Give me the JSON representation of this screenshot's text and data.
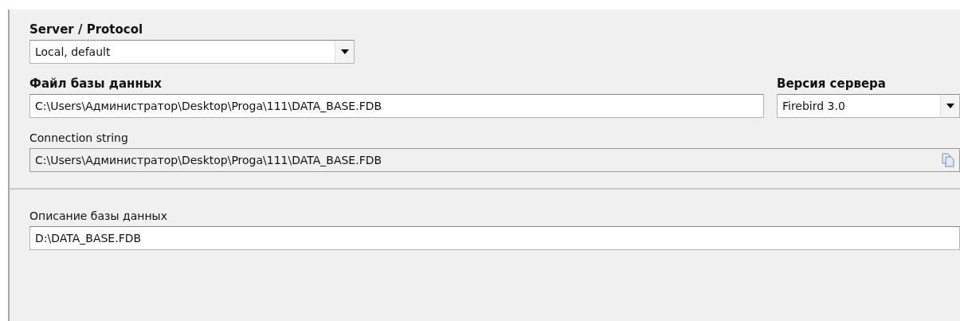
{
  "server_protocol": {
    "label": "Server / Protocol",
    "value": "Local, default"
  },
  "database_file": {
    "label": "Файл базы данных",
    "value": "C:\\Users\\Администратор\\Desktop\\Proga\\111\\DATA_BASE.FDB"
  },
  "server_version": {
    "label": "Версия сервера",
    "value": "Firebird 3.0"
  },
  "connection_string": {
    "label": "Connection string",
    "value": "C:\\Users\\Администратор\\Desktop\\Proga\\111\\DATA_BASE.FDB",
    "readonly": true
  },
  "description": {
    "label": "Описание базы данных",
    "value": "D:\\DATA_BASE.FDB"
  }
}
